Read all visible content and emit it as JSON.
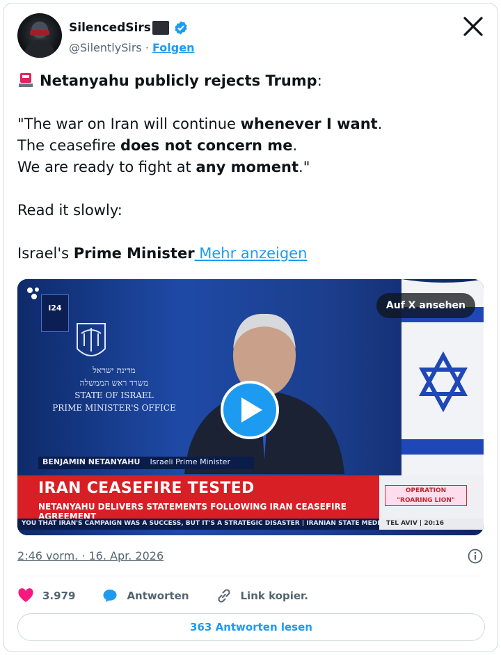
{
  "author": {
    "display_name": "SilencedSirs",
    "handle": "@SilentlySirs",
    "separator": "·",
    "follow_label": "Folgen"
  },
  "tweet": {
    "line1_bold": "Netanyahu publicly rejects Trump",
    "line1_rest": ":",
    "q1_a": "\"The war on Iran will continue ",
    "q1_b": "whenever I want",
    "q1_c": ".",
    "q2_a": "The ceasefire ",
    "q2_b": "does not concern me",
    "q2_c": ".",
    "q3_a": "We are ready to fight at ",
    "q3_b": "any moment",
    "q3_c": ".\"",
    "read_slowly": "Read it slowly:",
    "last_a": "Israel's ",
    "last_b": "Prime Minister",
    "more_label": " Mehr anzeigen"
  },
  "video": {
    "watch_on_x": "Auf X ansehen",
    "channel_logo": "i24",
    "office_lines": [
      "מדינת ישראל",
      "משרד ראש הממשלה",
      "STATE OF ISRAEL",
      "PRIME MINISTER'S OFFICE"
    ],
    "lower_third_name": "BENJAMIN NETANYAHU",
    "lower_third_role": "Israeli Prime Minister",
    "headline": "IRAN CEASEFIRE TESTED",
    "subheadline": "NETANYAHU DELIVERS STATEMENTS FOLLOWING IRAN CEASEFIRE AGREEMENT",
    "ticker": "YOU THAT IRAN'S CAMPAIGN WAS A SUCCESS, BUT IT'S A STRATEGIC DISASTER  |  IRANIAN STATE MEDIA SA",
    "operation_label": "OPERATION",
    "operation_name": "\"ROARING LION\"",
    "location": "TEL AVIV  |  20:16"
  },
  "meta": {
    "timestamp": "2:46 vorm. · 16. Apr. 2026"
  },
  "actions": {
    "likes": "3.979",
    "reply_label": "Antworten",
    "copy_link_label": "Link kopier."
  },
  "read_replies_label": "363 Antworten lesen",
  "colors": {
    "accent": "#1d9bf0",
    "like": "#f91880",
    "text": "#0f1419",
    "muted": "#536471"
  }
}
